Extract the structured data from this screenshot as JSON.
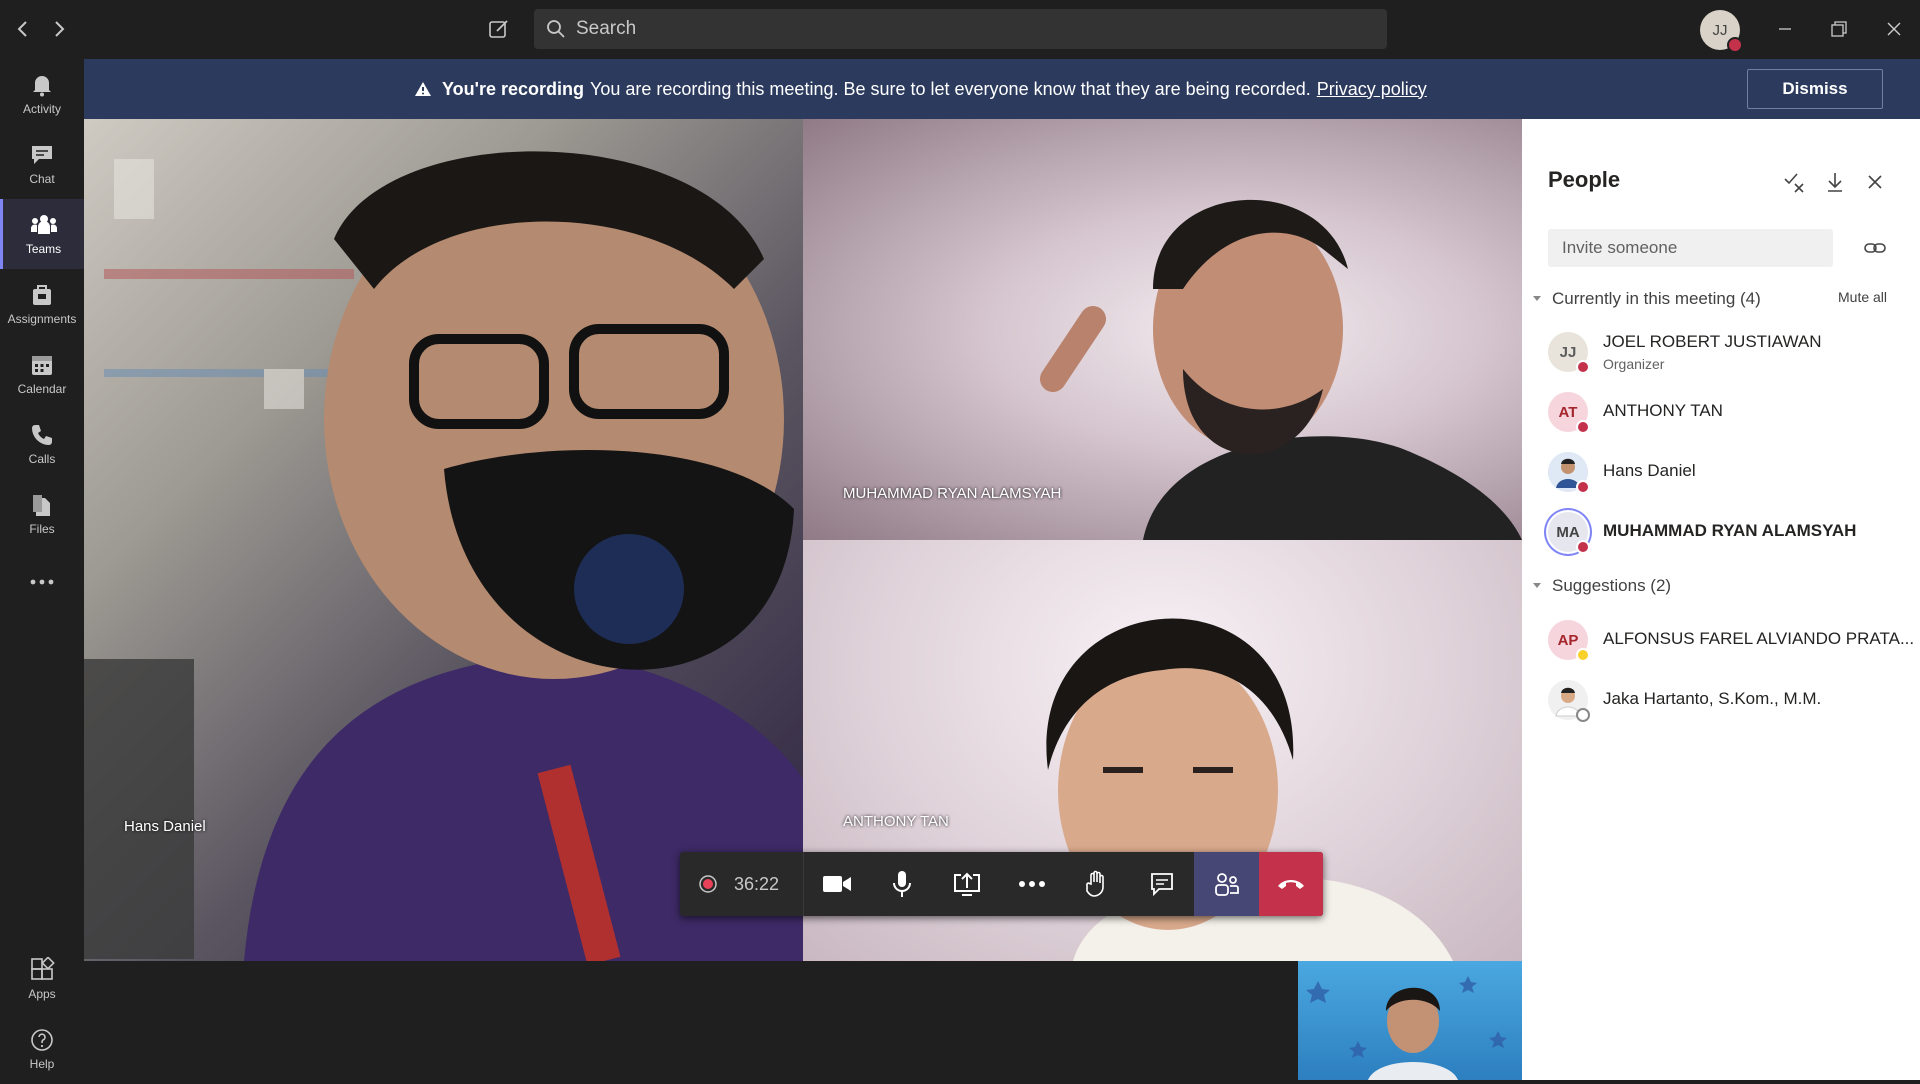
{
  "search": {
    "placeholder": "Search"
  },
  "me": {
    "initials": "JJ"
  },
  "rail": [
    {
      "label": "Activity",
      "icon": "bell-icon"
    },
    {
      "label": "Chat",
      "icon": "chat-icon"
    },
    {
      "label": "Teams",
      "icon": "teams-icon",
      "active": true
    },
    {
      "label": "Assignments",
      "icon": "assignments-icon"
    },
    {
      "label": "Calendar",
      "icon": "calendar-icon"
    },
    {
      "label": "Calls",
      "icon": "phone-icon"
    },
    {
      "label": "Files",
      "icon": "files-icon"
    },
    {
      "label": "Apps",
      "icon": "apps-icon"
    },
    {
      "label": "Help",
      "icon": "help-icon"
    }
  ],
  "banner": {
    "title": "You're recording",
    "message": "You are recording this meeting. Be sure to let everyone know that they are being recorded.",
    "link": "Privacy policy",
    "dismiss": "Dismiss"
  },
  "stage": {
    "tiles": [
      {
        "name": "Hans Daniel"
      },
      {
        "name": "MUHAMMAD RYAN ALAMSYAH"
      },
      {
        "name": "ANTHONY TAN"
      }
    ]
  },
  "controls": {
    "timer": "36:22"
  },
  "people": {
    "title": "People",
    "invite_placeholder": "Invite someone",
    "current_header": "Currently in this meeting (4)",
    "mute_all": "Mute all",
    "current": [
      {
        "initials": "JJ",
        "name": "JOEL ROBERT JUSTIAWAN",
        "role": "Organizer"
      },
      {
        "initials": "AT",
        "name": "ANTHONY TAN"
      },
      {
        "initials": "",
        "name": "Hans Daniel"
      },
      {
        "initials": "MA",
        "name": "MUHAMMAD RYAN ALAMSYAH"
      }
    ],
    "suggestions_header": "Suggestions (2)",
    "suggestions": [
      {
        "initials": "AP",
        "name": "ALFONSUS FAREL ALVIANDO PRATA..."
      },
      {
        "initials": "",
        "name": "Jaka Hartanto, S.Kom., M.M."
      }
    ]
  },
  "colors": {
    "accent": "#7f85f5",
    "banner": "#2b3a5d",
    "hangup": "#c4314b",
    "busy": "#c4314b"
  }
}
